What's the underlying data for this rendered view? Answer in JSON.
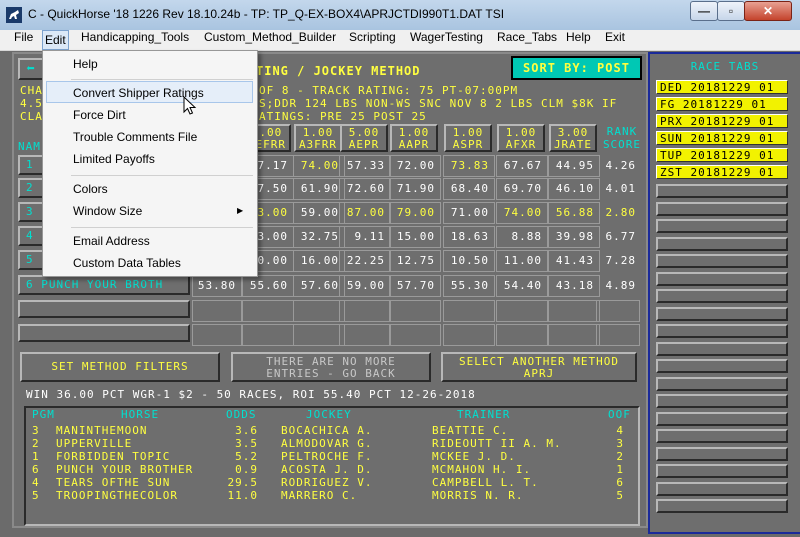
{
  "window": {
    "title": "C - QuickHorse '18 1226 Rev 18.10.24b - TP: TP_Q-EX-BOX4\\APRJCTDI990T1.DAT TSI",
    "min_glyph": "—",
    "max_glyph": "▫",
    "close_glyph": "✕"
  },
  "menu": [
    "File",
    "Edit",
    "Handicapping_Tools",
    "Custom_Method_Builder",
    "Scripting",
    "WagerTesting",
    "Race_Tabs",
    "Help",
    "Exit"
  ],
  "edit_menu": {
    "items": [
      "Help",
      "Convert Shipper Ratings",
      "Force Dirt",
      "Trouble Comments File",
      "Limited Payoffs",
      "Colors",
      "Window Size",
      "Email Address",
      "Custom Data Tables"
    ],
    "submenu_arrow": "▶"
  },
  "header": {
    "back_arrow": "⬅",
    "method_title": "TING / JOCKEY METHOD",
    "sort_button": "SORT BY: POST",
    "line1": "OF 8 - TRACK RATING: 75 PT-07:00PM",
    "line1_left": "CHA",
    "line2": "S;DDR 124 LBS NON-WS SNC NOV 8 2 LBS CLM $8K IF",
    "line2_left": "4.5",
    "line3": "ATINGS: PRE 25  POST 25",
    "line3_left": "CLA"
  },
  "columns": [
    {
      "weight": "1.00",
      "label": "AEFRR"
    },
    {
      "weight": "1.00",
      "label": "A3FRR"
    },
    {
      "weight": "5.00",
      "label": "AEPR"
    },
    {
      "weight": "1.00",
      "label": "AAPR"
    },
    {
      "weight": "1.00",
      "label": "ASPR"
    },
    {
      "weight": "1.00",
      "label": "AFXR"
    },
    {
      "weight": "3.00",
      "label": "JRATE"
    }
  ],
  "rank_header": "RANK\nSCORE",
  "name_header": "NAM",
  "rows": [
    {
      "pgm": "1",
      "horse": "",
      "c0": "",
      "c1": "7.17",
      "c2": "74.00",
      "c3": "57.33",
      "c4": "72.00",
      "c5": "73.83",
      "c6": "67.67",
      "c7": "44.95",
      "rank": "4.26"
    },
    {
      "pgm": "2",
      "horse": "",
      "c0": "",
      "c1": "7.50",
      "c2": "61.90",
      "c3": "72.60",
      "c4": "71.90",
      "c5": "68.40",
      "c6": "69.70",
      "c7": "46.10",
      "rank": "4.01"
    },
    {
      "pgm": "3",
      "horse": "",
      "c0": "",
      "c1": "3.00",
      "c2": "59.00",
      "c3": "87.00",
      "c4": "79.00",
      "c5": "71.00",
      "c6": "74.00",
      "c7": "56.88",
      "rank": "2.80"
    },
    {
      "pgm": "4",
      "horse": "",
      "c0": "",
      "c1": "3.00",
      "c2": "32.75",
      "c3": "9.11",
      "c4": "15.00",
      "c5": "18.63",
      "c6": "8.88",
      "c7": "39.98",
      "rank": "6.77"
    },
    {
      "pgm": "5",
      "horse": "",
      "c0": "",
      "c1": "0.00",
      "c2": "16.00",
      "c3": "22.25",
      "c4": "12.75",
      "c5": "10.50",
      "c6": "11.00",
      "c7": "41.43",
      "rank": "7.28"
    },
    {
      "pgm": "6",
      "horse": "PUNCH YOUR BROTH",
      "c0": "53.80",
      "c1": "55.60",
      "c2": "57.60",
      "c3": "59.00",
      "c4": "57.70",
      "c5": "55.30",
      "c6": "54.40",
      "c7": "43.18",
      "rank": "4.89"
    }
  ],
  "buttons": {
    "set_filters": "SET METHOD FILTERS",
    "no_more": "THERE ARE NO MORE\nENTRIES - GO BACK",
    "select_method": "SELECT ANOTHER METHOD\nAPRJ"
  },
  "stats_line": "WIN 36.00 PCT WGR-1 $2 - 50 RACES, ROI 55.40  PCT 12-26-2018",
  "results": {
    "headers": {
      "pgm": "PGM",
      "horse": "HORSE",
      "odds": "ODDS",
      "jockey": "JOCKEY",
      "trainer": "TRAINER",
      "oof": "OOF"
    },
    "rows": [
      {
        "pgm": "3",
        "horse": "MANINTHEMOON",
        "odds": "3.6",
        "jockey": "BOCACHICA A.",
        "trainer": "BEATTIE C.",
        "oof": "4"
      },
      {
        "pgm": "2",
        "horse": "UPPERVILLE",
        "odds": "3.5",
        "jockey": "ALMODOVAR G.",
        "trainer": "RIDEOUTT II A. M.",
        "oof": "3"
      },
      {
        "pgm": "1",
        "horse": "FORBIDDEN TOPIC",
        "odds": "5.2",
        "jockey": "PELTROCHE F.",
        "trainer": "MCKEE J. D.",
        "oof": "2"
      },
      {
        "pgm": "6",
        "horse": "PUNCH YOUR BROTHER",
        "odds": "0.9",
        "jockey": "ACOSTA J. D.",
        "trainer": "MCMAHON H. I.",
        "oof": "1"
      },
      {
        "pgm": "4",
        "horse": "TEARS OFTHE SUN",
        "odds": "29.5",
        "jockey": "RODRIGUEZ V.",
        "trainer": "CAMPBELL L. T.",
        "oof": "6"
      },
      {
        "pgm": "5",
        "horse": "TROOPINGTHECOLOR",
        "odds": "11.0",
        "jockey": "MARRERO C.",
        "trainer": "MORRIS N. R.",
        "oof": "5"
      }
    ]
  },
  "race_tabs": {
    "title": "RACE TABS",
    "items": [
      "DED 20181229 01",
      "FG  20181229 01",
      "PRX 20181229 01",
      "SUN 20181229 01",
      "TUP 20181229 01",
      "ZST 20181229 01"
    ]
  }
}
